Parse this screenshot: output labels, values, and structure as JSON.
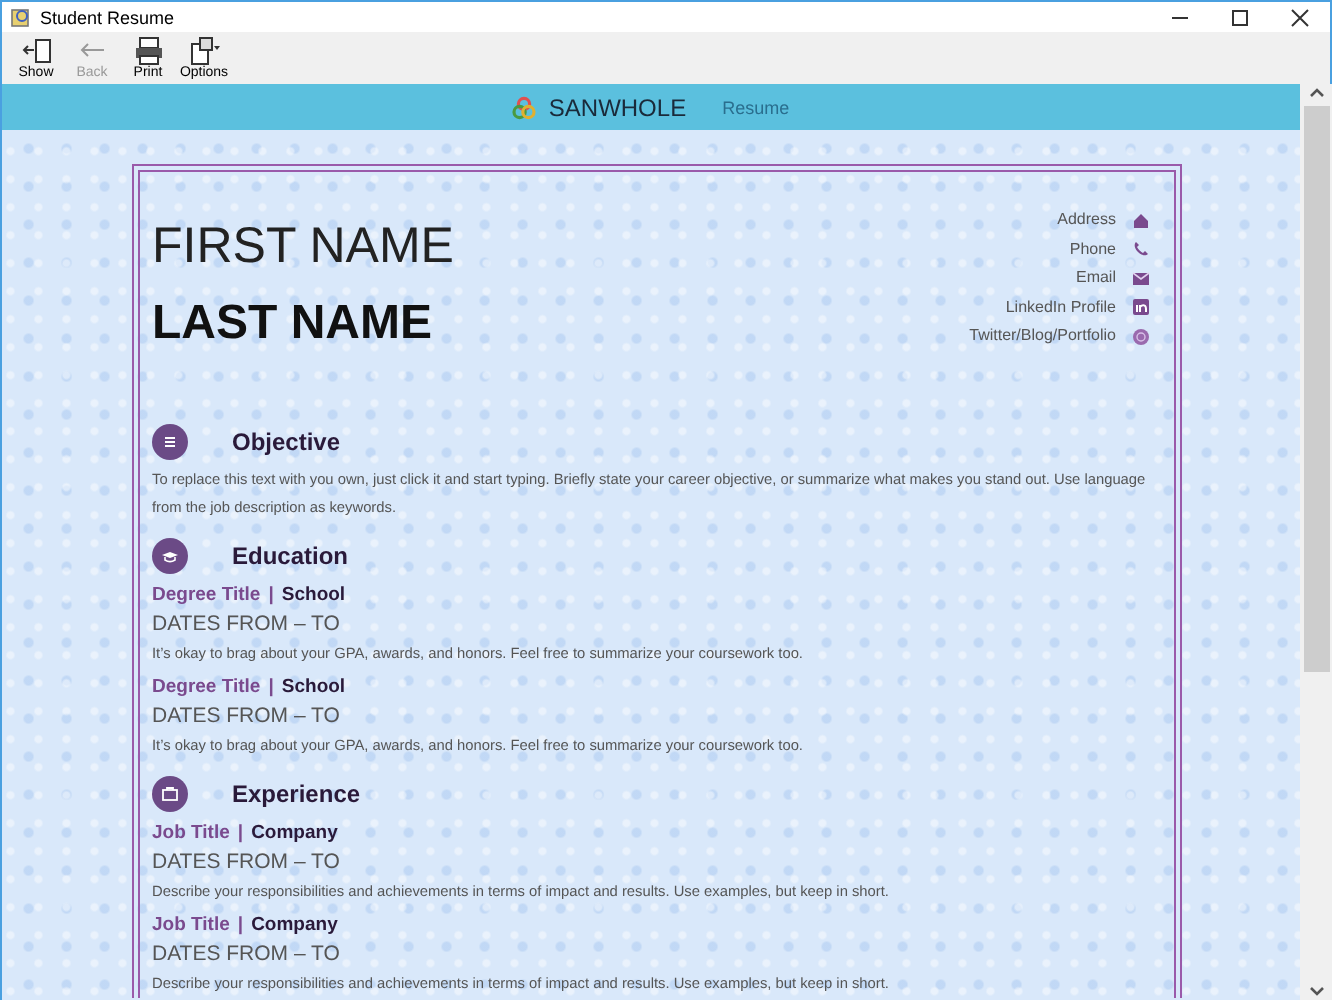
{
  "window": {
    "title": "Student Resume"
  },
  "toolbar": [
    {
      "label": "Show",
      "disabled": false
    },
    {
      "label": "Back",
      "disabled": true
    },
    {
      "label": "Print",
      "disabled": false
    },
    {
      "label": "Options",
      "disabled": false
    }
  ],
  "header": {
    "brand": "SANWHOLE",
    "nav": "Resume"
  },
  "resume": {
    "first_name": "FIRST NAME",
    "last_name": "LAST NAME",
    "contacts": [
      {
        "label": "Address"
      },
      {
        "label": "Phone"
      },
      {
        "label": "Email"
      },
      {
        "label": "LinkedIn Profile"
      },
      {
        "label": "Twitter/Blog/Portfolio"
      }
    ],
    "sections": [
      {
        "kind": "text",
        "heading": "Objective",
        "body": "To replace this text with you own, just click it and start typing. Briefly state your career objective, or summarize what makes you stand out. Use language from the job description as keywords."
      },
      {
        "kind": "entries",
        "heading": "Education",
        "entries": [
          {
            "title": "Degree Title",
            "separator": "|",
            "org": "School",
            "dates": "DATES FROM – TO",
            "description": "It’s okay to brag about your GPA, awards, and honors. Feel free to summarize your coursework too."
          },
          {
            "title": "Degree Title",
            "separator": "|",
            "org": "School",
            "dates": "DATES FROM – TO",
            "description": "It’s okay to brag about your GPA, awards, and honors. Feel free to summarize your coursework too."
          }
        ]
      },
      {
        "kind": "entries",
        "heading": "Experience",
        "entries": [
          {
            "title": "Job Title",
            "separator": "|",
            "org": "Company",
            "dates": "DATES FROM – TO",
            "description": "Describe your responsibilities and achievements in terms of impact and results. Use examples, but keep in short."
          },
          {
            "title": "Job Title",
            "separator": "|",
            "org": "Company",
            "dates": "DATES FROM – TO",
            "description": "Describe your responsibilities and achievements in terms of impact and results. Use examples, but keep in short."
          }
        ]
      }
    ]
  }
}
